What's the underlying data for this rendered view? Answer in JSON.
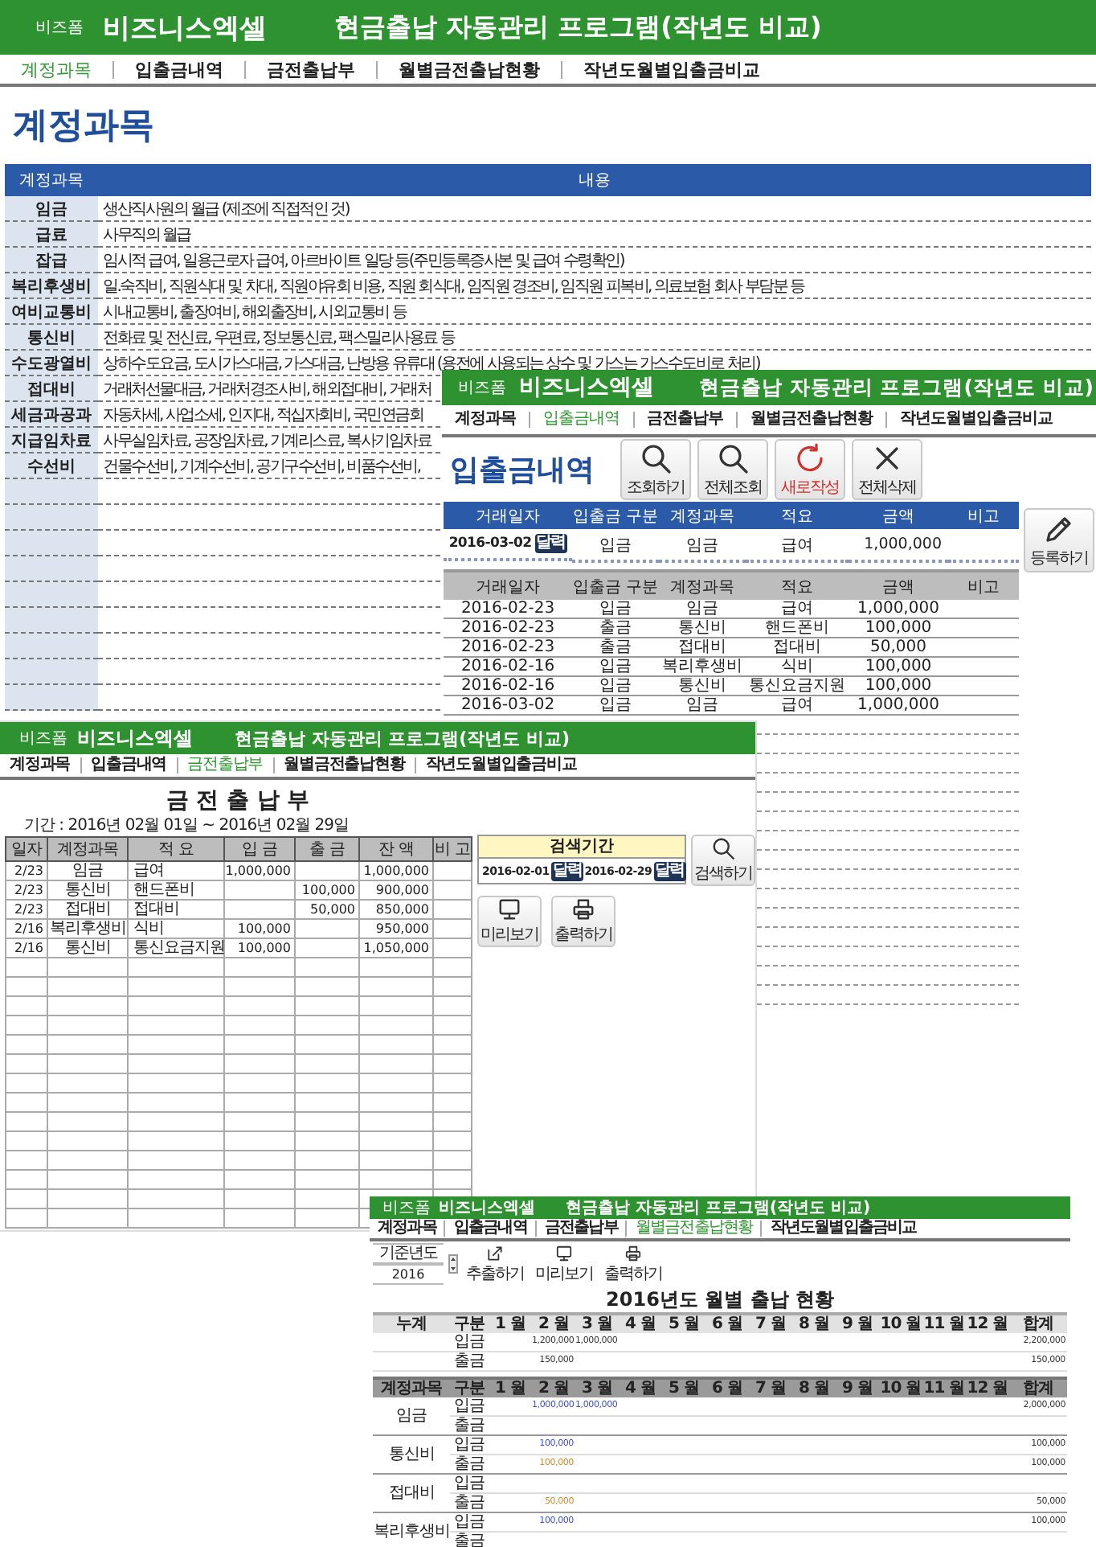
{
  "windows": [
    {
      "kind": "accounts",
      "header": {
        "tag": "비즈폼",
        "brand": "비즈니스엑셀",
        "title": "현금출납 자동관리 프로그램(작년도 비교)"
      },
      "nav": [
        {
          "label": "계정과목",
          "selected": true
        },
        {
          "label": "입출금내역",
          "selected": false
        },
        {
          "label": "금전출납부",
          "selected": false
        },
        {
          "label": "월별금전출납현황",
          "selected": false
        },
        {
          "label": "작년도월별입출금비교",
          "selected": false
        }
      ],
      "page_title": "계정과목",
      "table": {
        "columns": [
          "계정과목",
          "내용"
        ],
        "rows": [
          {
            "account": "임금",
            "description": "생산직사원의 월급 (제조에 직접적인 것)"
          },
          {
            "account": "급료",
            "description": "사무직의 월급"
          },
          {
            "account": "잡급",
            "description": "임시적 급여, 일용근로자 급여, 아르바이트 일당 등(주민등록증사본 및 급여 수령확인)"
          },
          {
            "account": "복리후생비",
            "description": "일.숙직비, 직원식대 및 차대, 직원야유회 비용, 직원  회식대, 임직원 경조비, 임직원 피복비, 의료보험 회사 부담분 등"
          },
          {
            "account": "여비교통비",
            "description": "시내교통비, 출장여비, 해외출장비, 시외교통비 등"
          },
          {
            "account": "통신비",
            "description": "전화료 및 전신료, 우편료, 정보통신료, 팩스밀리사용료  등"
          },
          {
            "account": "수도광열비",
            "description": "상하수도요금, 도시가스대금, 가스대금, 난방용 유류대 (용전에 사용되는 상수 및 가스는 가스수도비로 처리)"
          },
          {
            "account": "접대비",
            "description": "거래처선물대금, 거래처경조사비, 해외접대비, 거래처"
          },
          {
            "account": "세금과공과",
            "description": "자동차세, 사업소세, 인지대, 적십자회비, 국민연금회"
          },
          {
            "account": "지급임차료",
            "description": "사무실임차료, 공장임차료, 기계리스료, 복사기임차료"
          },
          {
            "account": "수선비",
            "description": "건물수선비, 기계수선비, 공기구수선비, 비품수선비,"
          }
        ]
      }
    },
    {
      "kind": "transactions",
      "header": {
        "tag": "비즈폼",
        "brand": "비즈니스엑셀",
        "title": "현금출납 자동관리 프로그램(작년도 비교)"
      },
      "nav": [
        {
          "label": "계정과목",
          "selected": false
        },
        {
          "label": "입출금내역",
          "selected": true
        },
        {
          "label": "금전출납부",
          "selected": false
        },
        {
          "label": "월별금전출납현황",
          "selected": false
        },
        {
          "label": "작년도월별입출금비교",
          "selected": false
        }
      ],
      "page_title": "입출금내역",
      "buttons": [
        {
          "kind": "query",
          "label": "조회하기"
        },
        {
          "kind": "query_all",
          "label": "전체조회"
        },
        {
          "kind": "new",
          "label": "새로작성"
        },
        {
          "kind": "delete_all",
          "label": "전체삭제"
        }
      ],
      "entry": {
        "columns": [
          "거래일자",
          "입출금 구분",
          "계정과목",
          "적요",
          "금액",
          "비고"
        ],
        "date": "2016-03-02",
        "calendar_button": "달력",
        "type": "입금",
        "account": "임금",
        "memo": "급여",
        "amount": "1,000,000"
      },
      "register_button": {
        "kind": "register",
        "label": "등록하기"
      },
      "list": {
        "columns": [
          "거래일자",
          "입출금 구분",
          "계정과목",
          "적요",
          "금액",
          "비고"
        ],
        "rows": [
          {
            "date": "2016-02-23",
            "type": "입금",
            "account": "임금",
            "memo": "급여",
            "amount": "1,000,000"
          },
          {
            "date": "2016-02-23",
            "type": "출금",
            "account": "통신비",
            "memo": "핸드폰비",
            "amount": "100,000"
          },
          {
            "date": "2016-02-23",
            "type": "출금",
            "account": "접대비",
            "memo": "접대비",
            "amount": "50,000"
          },
          {
            "date": "2016-02-16",
            "type": "입금",
            "account": "복리후생비",
            "memo": "식비",
            "amount": "100,000"
          },
          {
            "date": "2016-02-16",
            "type": "입금",
            "account": "통신비",
            "memo": "통신요금지원",
            "amount": "100,000"
          },
          {
            "date": "2016-03-02",
            "type": "입금",
            "account": "임금",
            "memo": "급여",
            "amount": "1,000,000"
          }
        ]
      }
    },
    {
      "kind": "ledger",
      "header": {
        "tag": "비즈폼",
        "brand": "비즈니스엑셀",
        "title": "현금출납 자동관리 프로그램(작년도 비교)"
      },
      "nav": [
        {
          "label": "계정과목",
          "selected": false
        },
        {
          "label": "입출금내역",
          "selected": false
        },
        {
          "label": "금전출납부",
          "selected": true
        },
        {
          "label": "월별금전출납현황",
          "selected": false
        },
        {
          "label": "작년도월별입출금비교",
          "selected": false
        }
      ],
      "page_title": "금 전 출 납 부",
      "period": "기간 : 2016년 02월 01일 ~ 2016년 02월 29일",
      "table": {
        "columns": [
          "일자",
          "계정과목",
          "적 요",
          "입 금",
          "출 금",
          "잔 액",
          "비 고"
        ],
        "rows": [
          {
            "date": "2/23",
            "account": "임금",
            "memo": "급여",
            "income": "1,000,000",
            "balance": "1,000,000"
          },
          {
            "date": "2/23",
            "account": "통신비",
            "memo": "핸드폰비",
            "expense": "100,000",
            "balance": "900,000"
          },
          {
            "date": "2/23",
            "account": "접대비",
            "memo": "접대비",
            "expense": "50,000",
            "balance": "850,000"
          },
          {
            "date": "2/16",
            "account": "복리후생비",
            "memo": "식비",
            "income": "100,000",
            "balance": "950,000"
          },
          {
            "date": "2/16",
            "account": "통신비",
            "memo": "통신요금지원",
            "income": "100,000",
            "balance": "1,050,000"
          }
        ]
      },
      "search": {
        "label": "검색기간",
        "from": "2016-02-01",
        "from_button": "달력",
        "to": "2016-02-29",
        "to_button": "달력"
      },
      "search_button": {
        "kind": "search",
        "label": "검색하기"
      },
      "buttons": [
        {
          "kind": "preview",
          "label": "미리보기"
        },
        {
          "kind": "print",
          "label": "출력하기"
        }
      ]
    },
    {
      "kind": "monthly",
      "header": {
        "tag": "비즈폼",
        "brand": "비즈니스엑셀",
        "title": "현금출납 자동관리 프로그램(작년도 비교)"
      },
      "nav": [
        {
          "label": "계정과목",
          "selected": false
        },
        {
          "label": "입출금내역",
          "selected": false
        },
        {
          "label": "금전출납부",
          "selected": false
        },
        {
          "label": "월별금전출납현황",
          "selected": true
        },
        {
          "label": "작년도월별입출금비교",
          "selected": false
        }
      ],
      "controls": {
        "year_label": "기준년도",
        "year": "2016",
        "buttons": [
          {
            "kind": "export",
            "label": "추출하기"
          },
          {
            "kind": "preview",
            "label": "미리보기"
          },
          {
            "kind": "print",
            "label": "출력하기"
          }
        ]
      },
      "page_title": "2016년도 월별 출납 현황",
      "summary": {
        "columns": [
          "누계",
          "구분",
          "1 월",
          "2 월",
          "3 월",
          "4 월",
          "5 월",
          "6 월",
          "7 월",
          "8 월",
          "9 월",
          "10 월",
          "11 월",
          "12 월",
          "합계"
        ],
        "rows": [
          {
            "label": "입금",
            "months": {
              "2": "1,200,000",
              "3": "1,000,000"
            },
            "total": "2,200,000"
          },
          {
            "label": "출금",
            "months": {
              "2": "150,000"
            },
            "total": "150,000"
          }
        ]
      },
      "detail": {
        "columns": [
          "계정과목",
          "구분",
          "1 월",
          "2 월",
          "3 월",
          "4 월",
          "5 월",
          "6 월",
          "7 월",
          "8 월",
          "9 월",
          "10 월",
          "11 월",
          "12 월",
          "합계"
        ],
        "groups": [
          {
            "account": "임금",
            "rows": [
              {
                "kind": "in",
                "label": "입금",
                "months": {
                  "2": "1,000,000",
                  "3": "1,000,000"
                },
                "total": "2,000,000"
              },
              {
                "kind": "out",
                "label": "출금"
              }
            ]
          },
          {
            "account": "통신비",
            "rows": [
              {
                "kind": "in",
                "label": "입금",
                "months": {
                  "2": "100,000"
                },
                "total": "100,000"
              },
              {
                "kind": "out",
                "label": "출금",
                "months": {
                  "2": "100,000"
                },
                "total": "100,000"
              }
            ]
          },
          {
            "account": "접대비",
            "rows": [
              {
                "kind": "in",
                "label": "입금"
              },
              {
                "kind": "out",
                "label": "출금",
                "months": {
                  "2": "50,000"
                },
                "total": "50,000"
              }
            ]
          },
          {
            "account": "복리후생비",
            "rows": [
              {
                "kind": "in",
                "label": "입금",
                "months": {
                  "2": "100,000"
                },
                "total": "100,000"
              },
              {
                "kind": "out",
                "label": "출금"
              }
            ]
          }
        ]
      }
    }
  ]
}
